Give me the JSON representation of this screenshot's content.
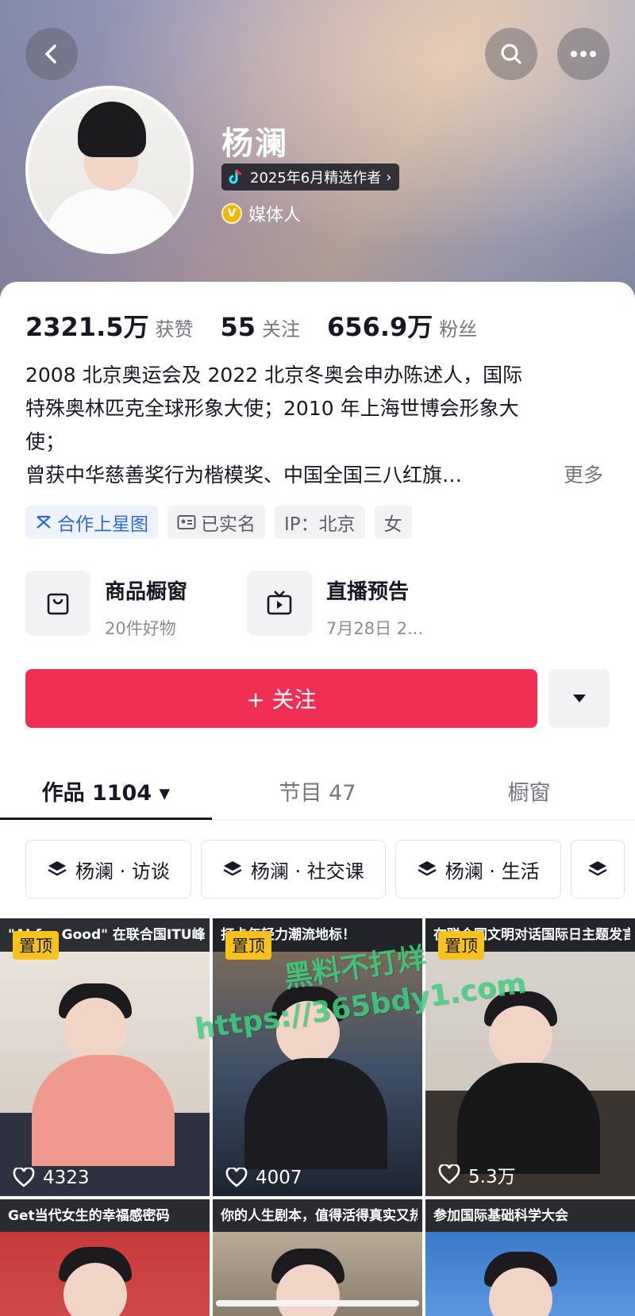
{
  "profile": {
    "name": "杨澜",
    "creator_badge": "2025年6月精选作者",
    "role": "媒体人"
  },
  "stats": {
    "likes": {
      "value": "2321.5万",
      "label": "获赞"
    },
    "following": {
      "value": "55",
      "label": "关注"
    },
    "followers": {
      "value": "656.9万",
      "label": "粉丝"
    }
  },
  "bio": {
    "lines": [
      "2008 北京奥运会及 2022 北京冬奥会申办陈述人，国际",
      "特殊奥林匹克全球形象大使；2010 年上海世博会形象大",
      "使；",
      "曾获中华慈善奖行为楷模奖、中国全国三八红旗…"
    ],
    "more": "更多"
  },
  "tags": [
    "合作上星图",
    "已实名",
    "IP：北京",
    "女"
  ],
  "shop": {
    "window": {
      "title": "商品橱窗",
      "sub": "20件好物"
    },
    "live": {
      "title": "直播预告",
      "sub": "7月28日 2..."
    }
  },
  "actions": {
    "follow": "+ 关注"
  },
  "tabs": [
    {
      "label": "作品 1104 ▾"
    },
    {
      "label": "节目 47"
    },
    {
      "label": "橱窗"
    }
  ],
  "collections": [
    "杨澜 · 访谈",
    "杨澜 · 社交课",
    "杨澜 · 生活"
  ],
  "videos": [
    {
      "title": "\"AI for Good\" 在联合国ITU峰会致辞",
      "pinned": "置顶",
      "likes": "4323"
    },
    {
      "title": "打卡年轻力潮流地标！",
      "pinned": "置顶",
      "likes": "4007"
    },
    {
      "title": "在联合国文明对话国际日主题发言：中华造物智慧",
      "pinned": "置顶",
      "likes": "5.3万"
    },
    {
      "title": "Get当代女生的幸福感密码",
      "pinned": "",
      "likes": ""
    },
    {
      "title": "你的人生剧本，值得活得真实又热烈",
      "pinned": "",
      "likes": ""
    },
    {
      "title": "参加国际基础科学大会",
      "pinned": "",
      "likes": ""
    }
  ],
  "watermark": {
    "line1": "黑料不打烊",
    "line2": "https://365bdy1.com"
  },
  "colors": {
    "accent": "#f02e54",
    "pin": "#f7c21b",
    "verified": "#f2b705",
    "link": "#2c6bd8"
  }
}
